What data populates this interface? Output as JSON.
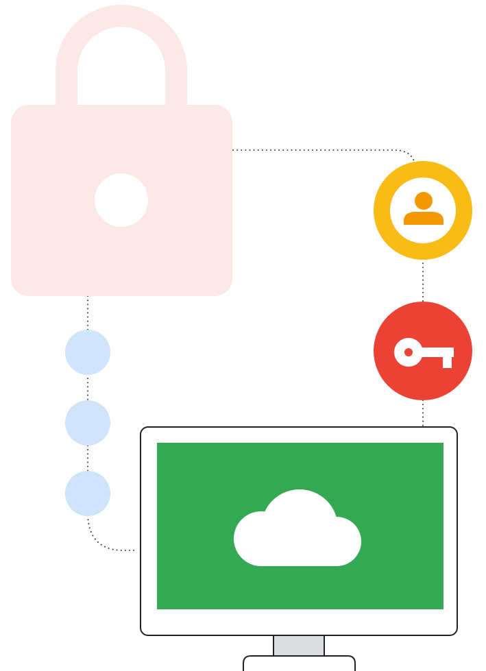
{
  "illustration": {
    "elements": {
      "lock": {
        "icon": "padlock-icon",
        "color": "#FCE8E6"
      },
      "user_badge": {
        "icon": "person-icon",
        "ring_color": "#F9BB16",
        "figure_color": "#F29900"
      },
      "key_badge": {
        "icon": "key-icon",
        "color": "#EA4335"
      },
      "steps": {
        "count": 3,
        "color": "#D2E3FC"
      },
      "monitor": {
        "screen_color": "#34A853",
        "stand_color": "#DADCE0",
        "outline_color": "#202124",
        "icon": "cloud-icon"
      },
      "connectors": {
        "style": "dotted",
        "color": "#3C4043"
      }
    }
  }
}
